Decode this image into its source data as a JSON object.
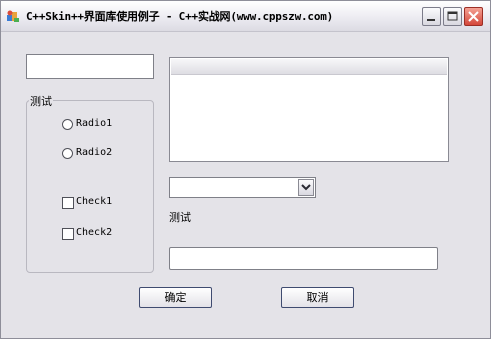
{
  "window": {
    "title": "C++Skin++界面库使用例子 - C++实战网(www.cppszw.com)"
  },
  "form": {
    "edit_top_value": "",
    "group_label": "测试",
    "radios": [
      {
        "label": "Radio1",
        "checked": false
      },
      {
        "label": "Radio2",
        "checked": false
      }
    ],
    "checkboxes": [
      {
        "label": "Check1",
        "checked": false
      },
      {
        "label": "Check2",
        "checked": false
      }
    ],
    "combo_value": "",
    "static_label": "测试",
    "edit_bottom_value": "",
    "ok_label": "确定",
    "cancel_label": "取消"
  },
  "icons": {
    "app": "app-icon",
    "minimize": "minimize-icon",
    "maximize": "maximize-icon",
    "close": "close-icon",
    "dropdown": "chevron-down-icon"
  },
  "colors": {
    "window_bg": "#e4e3e8",
    "close_button": "#d4473a",
    "button_border": "#3f4b70"
  }
}
